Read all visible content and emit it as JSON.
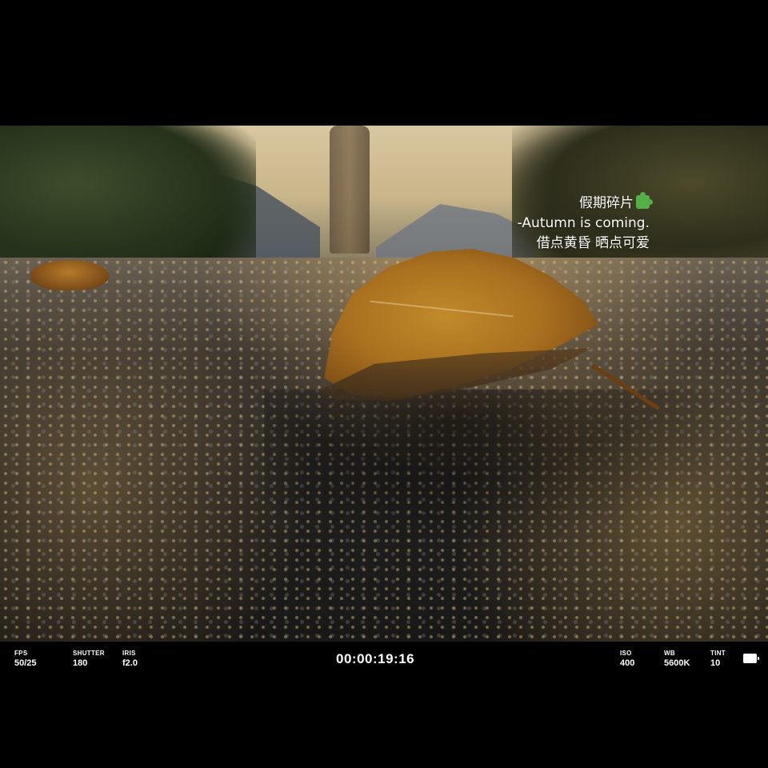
{
  "overlay": {
    "line1": "假期碎片",
    "line2": "-Autumn is coming.",
    "line3": "借点黄昏 晒点可爱",
    "icon": "puzzle-piece-icon"
  },
  "hud": {
    "fps": {
      "label": "FPS",
      "value": "50/25"
    },
    "shutter": {
      "label": "SHUTTER",
      "value": "180"
    },
    "iris": {
      "label": "IRIS",
      "value": "f2.0"
    },
    "timecode": "00:00:19:16",
    "iso": {
      "label": "ISO",
      "value": "400"
    },
    "wb": {
      "label": "WB",
      "value": "5600K"
    },
    "tint": {
      "label": "TINT",
      "value": "10"
    },
    "battery_icon": "battery-icon"
  },
  "colors": {
    "letterbox": "#000000",
    "hud_text": "#ffffff",
    "accent_green": "#56b04a"
  }
}
